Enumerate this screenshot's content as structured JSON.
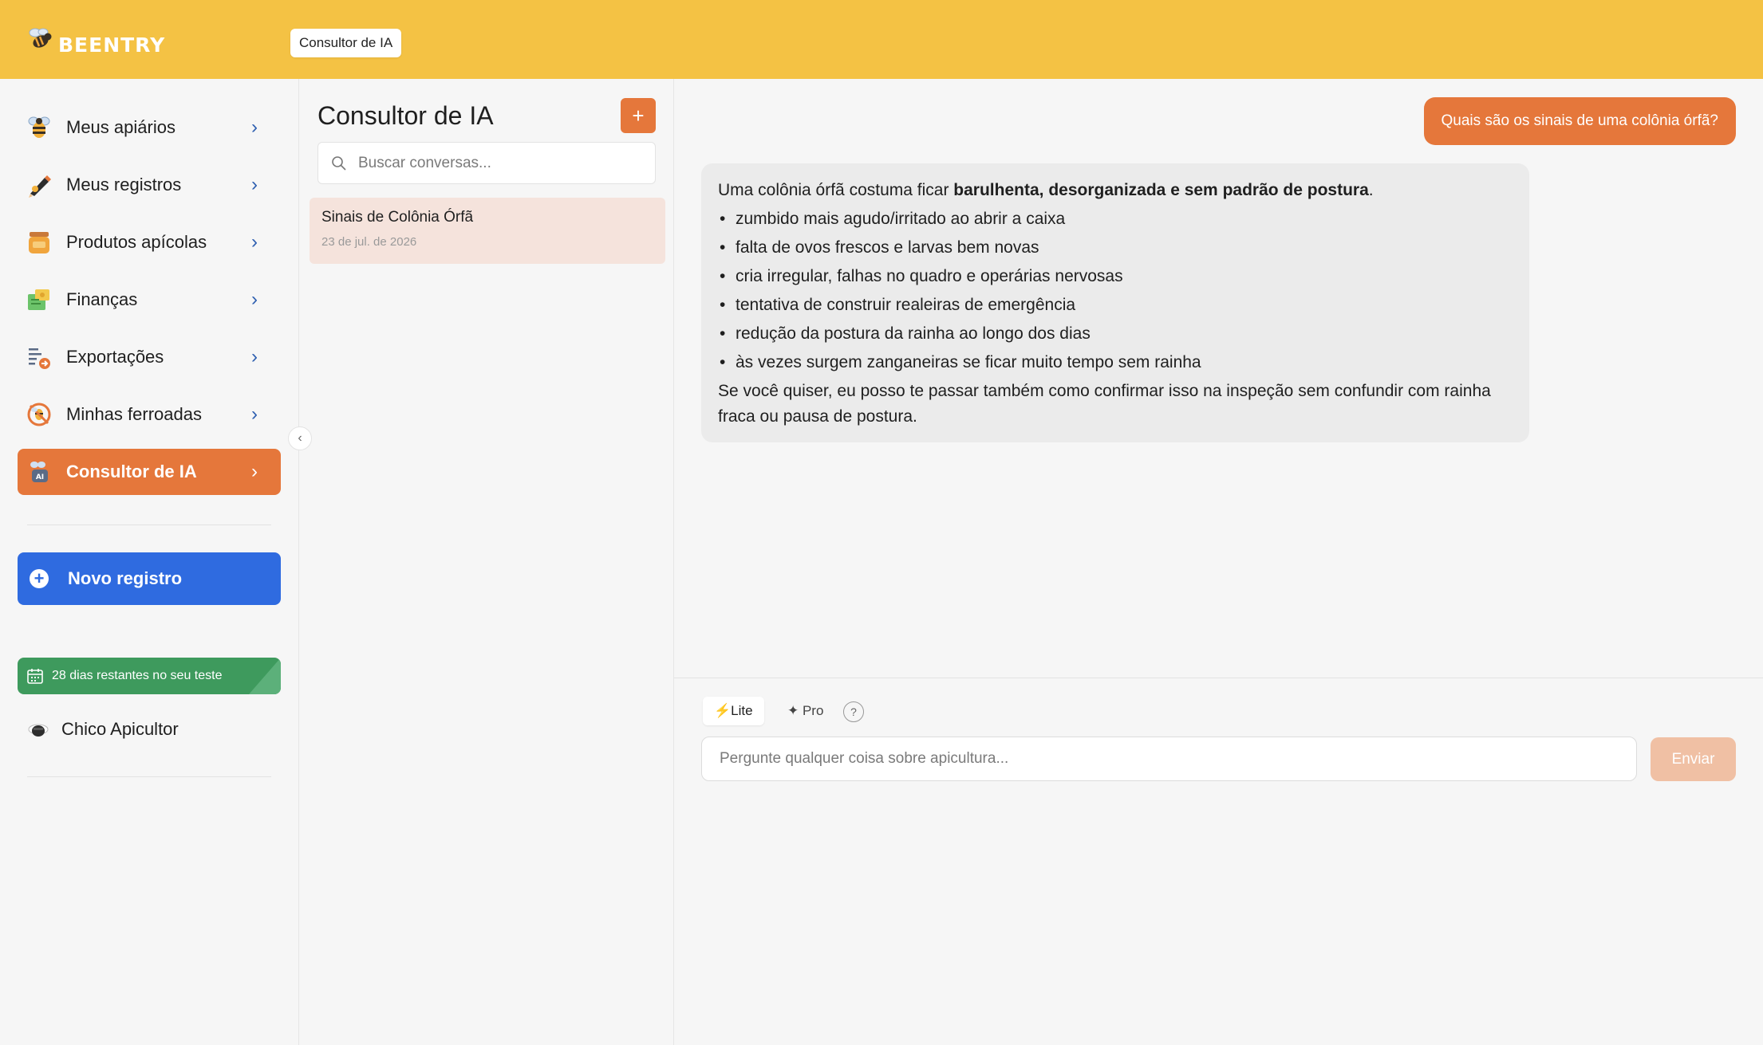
{
  "header": {
    "logo_text": "BEENTRY",
    "active_tab": "Consultor de IA"
  },
  "sidebar": {
    "items": [
      {
        "label": "Meus apiários",
        "icon": "bee-icon"
      },
      {
        "label": "Meus registros",
        "icon": "pen-icon"
      },
      {
        "label": "Produtos apícolas",
        "icon": "honey-jar-icon"
      },
      {
        "label": "Finanças",
        "icon": "money-icon"
      },
      {
        "label": "Exportações",
        "icon": "export-document-icon"
      },
      {
        "label": "Minhas ferroadas",
        "icon": "sting-icon"
      },
      {
        "label": "Consultor de IA",
        "icon": "ai-advisor-icon",
        "active": true
      }
    ],
    "new_record_label": "Novo registro",
    "trial_label": "28 dias restantes no seu teste",
    "user_name": "Chico Apicultor"
  },
  "conversations": {
    "title": "Consultor de IA",
    "add_label": "+",
    "search_placeholder": "Buscar conversas...",
    "items": [
      {
        "title": "Sinais de Colônia Órfã",
        "date": "23 de jul. de 2026"
      }
    ]
  },
  "chat": {
    "user_message": "Quais são os sinais de uma colônia órfã?",
    "ai_message": {
      "intro_prefix": "Uma colônia órfã costuma ficar ",
      "intro_bold": "barulhenta, desorganizada e sem padrão de postura",
      "intro_suffix": ".",
      "bullets": [
        "zumbido mais agudo/irritado ao abrir a caixa",
        "falta de ovos frescos e larvas bem novas",
        "cria irregular, falhas no quadro e operárias nervosas",
        "tentativa de construir realeiras de emergência",
        "redução da postura da rainha ao longo dos dias",
        "às vezes surgem zanganeiras se ficar muito tempo sem rainha"
      ],
      "outro": "Se você quiser, eu posso te passar também como confirmar isso na inspeção sem confundir com rainha fraca ou pausa de postura."
    },
    "mode_lite_label": "Lite",
    "mode_pro_label": "Pro",
    "help_label": "?",
    "input_placeholder": "Pergunte qualquer coisa sobre apicultura...",
    "send_label": "Enviar"
  },
  "colors": {
    "header": "#f4c244",
    "accent_orange": "#e5773b",
    "primary_blue": "#2f6be0",
    "trial_green": "#3e9a5d"
  }
}
